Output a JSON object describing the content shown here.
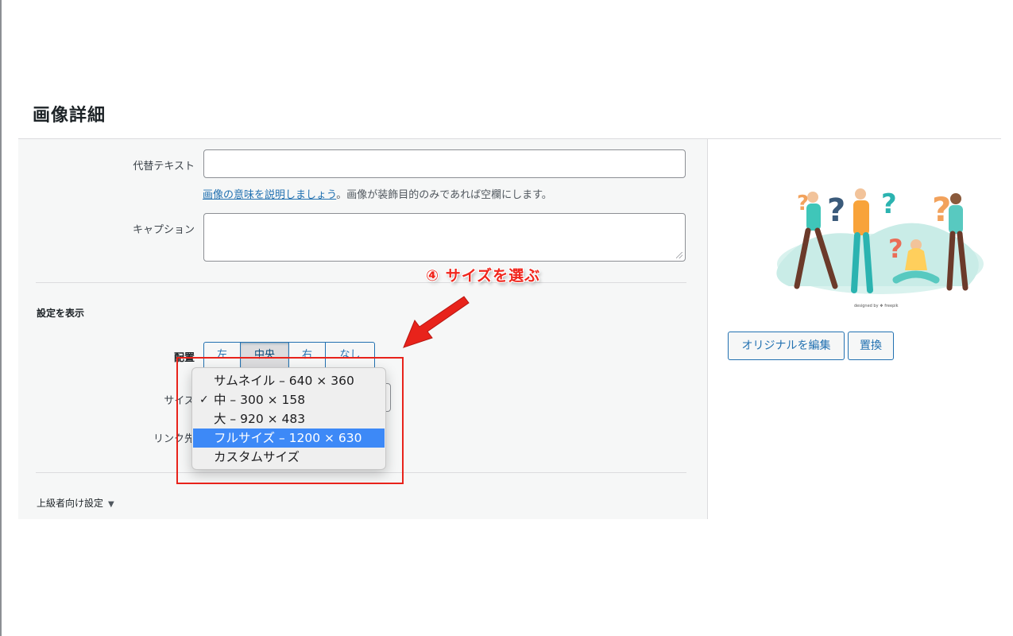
{
  "page": {
    "title": "画像詳細"
  },
  "form": {
    "alt_text": {
      "label": "代替テキスト",
      "value": ""
    },
    "help": {
      "link": "画像の意味を説明しましょう",
      "rest": "。画像が装飾目的のみであれば空欄にします。"
    },
    "caption": {
      "label": "キャプション",
      "value": ""
    }
  },
  "display_settings": {
    "title": "設定を表示",
    "alignment": {
      "label": "配置",
      "options": [
        "左",
        "中央",
        "右",
        "なし"
      ],
      "selected": "中央"
    },
    "size": {
      "label": "サイズ"
    },
    "link": {
      "label": "リンク先"
    }
  },
  "size_dropdown": {
    "options": [
      {
        "label": "サムネイル – 640 × 360",
        "checked": false,
        "highlighted": false
      },
      {
        "label": "中 – 300 × 158",
        "checked": true,
        "highlighted": false
      },
      {
        "label": "大 – 920 × 483",
        "checked": false,
        "highlighted": false
      },
      {
        "label": "フルサイズ – 1200 × 630",
        "checked": false,
        "highlighted": true
      },
      {
        "label": "カスタムサイズ",
        "checked": false,
        "highlighted": false
      }
    ],
    "check_mark": "✓"
  },
  "advanced": {
    "label": "上級者向け設定",
    "caret": "▼"
  },
  "annotation": {
    "text": "④ サイズを選ぶ",
    "color": "#e8231b"
  },
  "preview": {
    "credit": "designed by ❖ freepik"
  },
  "actions": {
    "edit_original": "オリジナルを編集",
    "replace": "置換"
  },
  "colors": {
    "accent": "#2271b1",
    "panel_bg": "#f6f7f7",
    "highlight": "#3d89f7"
  }
}
